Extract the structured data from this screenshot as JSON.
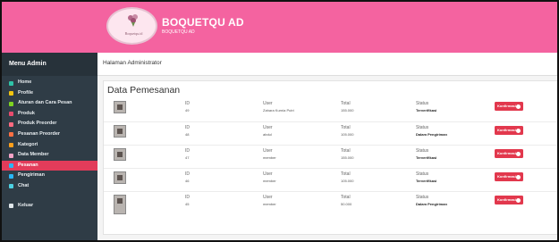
{
  "header": {
    "logo_text": "Boquetqu.id",
    "brand_title": "BOQUETQU AD",
    "brand_sub": "BOQUETQU AD",
    "bg_color": "#f463a0"
  },
  "sidebar": {
    "title": "Menu Admin",
    "items": [
      {
        "label": "Home",
        "icon": "home-icon",
        "color": "#2ec4a8"
      },
      {
        "label": "Profile",
        "icon": "user-icon",
        "color": "#f1c40f"
      },
      {
        "label": "Aturan dan Cara Pesan",
        "icon": "rules-icon",
        "color": "#7ed321"
      },
      {
        "label": "Produk",
        "icon": "product-icon",
        "color": "#e84c6e"
      },
      {
        "label": "Produk Preorder",
        "icon": "preorder-product-icon",
        "color": "#ff6b81"
      },
      {
        "label": "Pesanan Preorder",
        "icon": "preorder-order-icon",
        "color": "#ff7043"
      },
      {
        "label": "Kategori",
        "icon": "category-icon",
        "color": "#ff9f1c"
      },
      {
        "label": "Data Member",
        "icon": "members-icon",
        "color": "#f5a3c7"
      },
      {
        "label": "Pesanan",
        "icon": "order-icon",
        "color": "#29b6f6"
      },
      {
        "label": "Pengiriman",
        "icon": "shipping-icon",
        "color": "#29b6f6"
      },
      {
        "label": "Chat",
        "icon": "chat-icon",
        "color": "#4dd0e1"
      }
    ],
    "active_index": 8,
    "logout": {
      "label": "Keluar",
      "icon": "logout-icon"
    }
  },
  "topbar": {
    "title": "Halaman Administrator"
  },
  "panel": {
    "title": "Data Pemesanan",
    "columns": {
      "id": "ID",
      "user": "User",
      "total": "Total",
      "status": "Status"
    },
    "button_label": "Konfirmasi",
    "rows": [
      {
        "id": "49",
        "user": "Zahara Kurnia Putri",
        "total": "155.000",
        "status": "Terverifikasi"
      },
      {
        "id": "48",
        "user": "abdul",
        "total": "105.000",
        "status": "Dalam Pengiriman"
      },
      {
        "id": "47",
        "user": "member",
        "total": "155.000",
        "status": "Terverifikasi"
      },
      {
        "id": "46",
        "user": "member",
        "total": "105.000",
        "status": "Terverifikasi"
      },
      {
        "id": "45",
        "user": "member",
        "total": "50.000",
        "status": "Dalam Pengiriman"
      }
    ]
  }
}
